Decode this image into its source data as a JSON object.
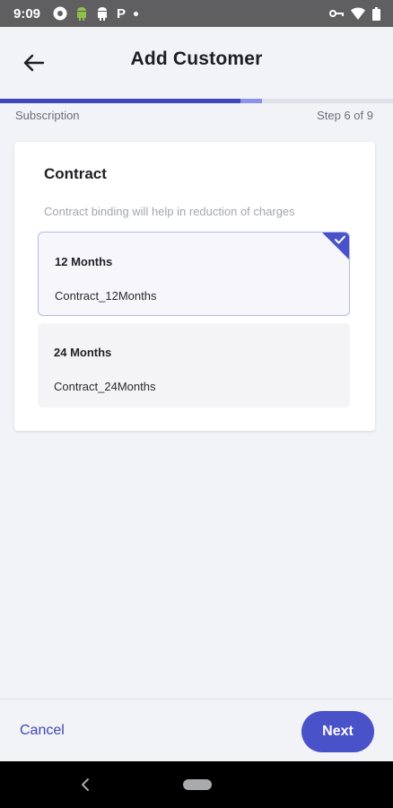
{
  "status_bar": {
    "time": "9:09",
    "icons_left": [
      "chrome-icon",
      "android-icon",
      "android-icon",
      "p-icon",
      "dot-icon"
    ],
    "icons_right": [
      "vpn-key-icon",
      "wifi-icon",
      "battery-icon"
    ],
    "p_glyph": "P"
  },
  "header": {
    "back_icon": "arrow-left-icon",
    "title": "Add Customer"
  },
  "progress": {
    "step_label": "Subscription",
    "step_text": "Step 6 of 9",
    "current_step": 6,
    "total_steps": 9,
    "accent_color": "#3f48b8",
    "light_color": "#8c93e6"
  },
  "contract_card": {
    "title": "Contract",
    "subtitle": "Contract binding will help in reduction of charges",
    "options": [
      {
        "title": "12 Months",
        "code": "Contract_12Months",
        "selected": true
      },
      {
        "title": "24 Months",
        "code": "Contract_24Months",
        "selected": false
      }
    ]
  },
  "footer": {
    "cancel_label": "Cancel",
    "next_label": "Next",
    "primary_color": "#4a52c9"
  },
  "nav_bar": {
    "back_icon": "nav-back-icon",
    "home_icon": "nav-home-pill-icon"
  }
}
